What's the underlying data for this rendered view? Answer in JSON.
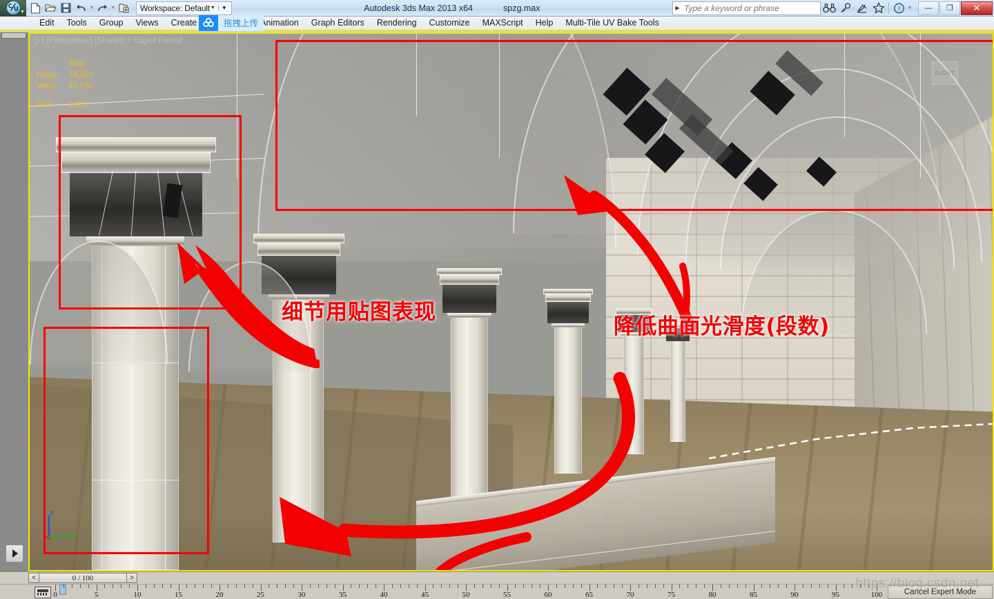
{
  "window": {
    "app_title": "Autodesk 3ds Max  2013 x64",
    "file_name": "spzg.max",
    "minimize_label": "—",
    "restore_label": "❐",
    "close_label": "✕"
  },
  "quick_access": {
    "workspace_label": "Workspace: Default",
    "icons": [
      "new-file-icon",
      "open-file-icon",
      "save-file-icon",
      "undo-icon",
      "redo-icon",
      "set-project-folder-icon"
    ]
  },
  "search": {
    "placeholder": "Type a keyword or phrase",
    "value": "",
    "icons": [
      "binoculars-icon",
      "key-icon",
      "satellite-dish-icon",
      "star-icon",
      "help-icon"
    ]
  },
  "menu": {
    "items": [
      {
        "label": "Edit"
      },
      {
        "label": "Tools"
      },
      {
        "label": "Group"
      },
      {
        "label": "Views"
      },
      {
        "label": "Create"
      },
      {
        "label": "Animation"
      },
      {
        "label": "Graph Editors"
      },
      {
        "label": "Rendering"
      },
      {
        "label": "Customize"
      },
      {
        "label": "MAXScript"
      },
      {
        "label": "Help"
      },
      {
        "label": "Multi-Tile UV Bake Tools"
      }
    ]
  },
  "upload_widget": {
    "label": "拖拽上传",
    "icon": "cloud-upload-icon",
    "accent": "#1a8cff"
  },
  "viewport": {
    "label": "[+] [Perspective] [Shaded + Edged Faces]",
    "viewcube_face": "RIGHT",
    "stats": {
      "header": "Total",
      "rows": [
        {
          "key": "Polys:",
          "value": "74,582"
        },
        {
          "key": "Verts:",
          "value": "40,190"
        }
      ],
      "fps_key": "FPS:",
      "fps_value": "8.810"
    },
    "axis": {
      "x": "x",
      "y": "y",
      "z": "z"
    }
  },
  "annotations": {
    "accent": "#f40000",
    "notes": [
      {
        "text": "细节用贴图表现",
        "id": "note-texture-detail"
      },
      {
        "text": "降低曲面光滑度(段数)",
        "id": "note-reduce-smoothness"
      }
    ]
  },
  "timebar": {
    "prev_label": "<",
    "next_label": ">",
    "frame_display": "0 / 100"
  },
  "ruler": {
    "ticks": [
      0,
      5,
      10,
      15,
      20,
      25,
      30,
      35,
      40,
      45,
      50,
      55,
      60,
      65,
      70,
      75,
      80,
      85,
      90,
      95,
      100
    ],
    "min": 0,
    "max": 100
  },
  "status": {
    "expert_mode_button": "Cancel Expert Mode",
    "key_mode_icon": "key-mode-icon"
  },
  "watermark": {
    "text": "https://blog.csdn.net"
  }
}
